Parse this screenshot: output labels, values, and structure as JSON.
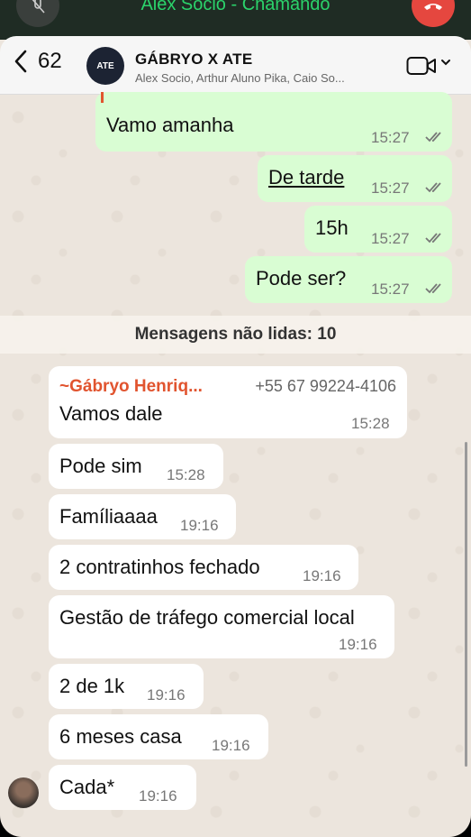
{
  "call": {
    "status": "Alex Socio - Chamando"
  },
  "header": {
    "back_count": "62",
    "group_avatar_text": "ATE",
    "title": "GÁBRYO X ATE",
    "subtitle": "Alex Socio, Arthur Aluno Pika, Caio So..."
  },
  "messages": {
    "m1": {
      "text": "Vamo amanha",
      "time": "15:27"
    },
    "m2": {
      "text": "De tarde",
      "time": "15:27"
    },
    "m3": {
      "text": "15h",
      "time": "15:27"
    },
    "m4": {
      "text": "Pode ser?",
      "time": "15:27"
    },
    "unread": "Mensagens não lidas: 10",
    "m5": {
      "sender": "~Gábryo Henriq...",
      "phone": "+55 67 99224-4106",
      "text": "Vamos dale",
      "time": "15:28"
    },
    "m6": {
      "text": "Pode sim",
      "time": "15:28"
    },
    "m7": {
      "text": "Famíliaaaa",
      "time": "19:16"
    },
    "m8": {
      "text": "2 contratinhos fechado",
      "time": "19:16"
    },
    "m9": {
      "text": "Gestão de tráfego comercial local",
      "time": "19:16"
    },
    "m10": {
      "text": "2 de 1k",
      "time": "19:16"
    },
    "m11": {
      "text": "6 meses casa",
      "time": "19:16"
    },
    "m12": {
      "text": "Cada*",
      "time": "19:16"
    }
  },
  "colors": {
    "outgoing": "#d9fdd3",
    "incoming": "#ffffff",
    "sender_name": "#e1542f",
    "call_green": "#2bd36b"
  },
  "icons": [
    "mic-off-icon",
    "end-call-icon",
    "back-chevron-icon",
    "video-call-icon",
    "chevron-down-icon",
    "double-check-icon"
  ]
}
